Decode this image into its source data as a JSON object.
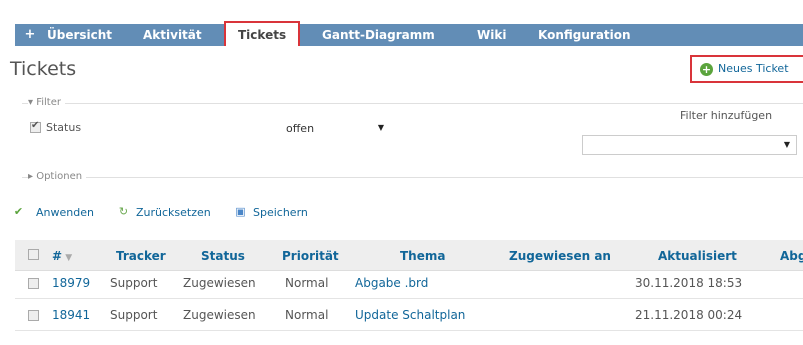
{
  "nav": {
    "plus": "+",
    "tabs": [
      "Übersicht",
      "Aktivität",
      "Tickets",
      "Gantt-Diagramm",
      "Wiki",
      "Konfiguration"
    ]
  },
  "page": {
    "title": "Tickets",
    "new_ticket": "Neues Ticket"
  },
  "filter": {
    "legend": "Filter",
    "status_label": "Status",
    "status_value": "offen",
    "add_filter_label": "Filter hinzufügen",
    "options_legend": "Optionen"
  },
  "actions": {
    "apply": "Anwenden",
    "reset": "Zurücksetzen",
    "save": "Speichern"
  },
  "table": {
    "headers": [
      "#",
      "Tracker",
      "Status",
      "Priorität",
      "Thema",
      "Zugewiesen an",
      "Aktualisiert",
      "Abg"
    ],
    "rows": [
      {
        "id": "18979",
        "tracker": "Support",
        "status": "Zugewiesen",
        "priority": "Normal",
        "subject": "Abgabe .brd",
        "assignee": "",
        "updated": "30.11.2018 18:53"
      },
      {
        "id": "18941",
        "tracker": "Support",
        "status": "Zugewiesen",
        "priority": "Normal",
        "subject": "Update Schaltplan",
        "assignee": "",
        "updated": "21.11.2018 00:24"
      }
    ]
  },
  "colors": {
    "nav_bar": "#628db6",
    "link": "#116699",
    "highlight_border": "#d9343a",
    "add_icon": "#5ba43d"
  }
}
